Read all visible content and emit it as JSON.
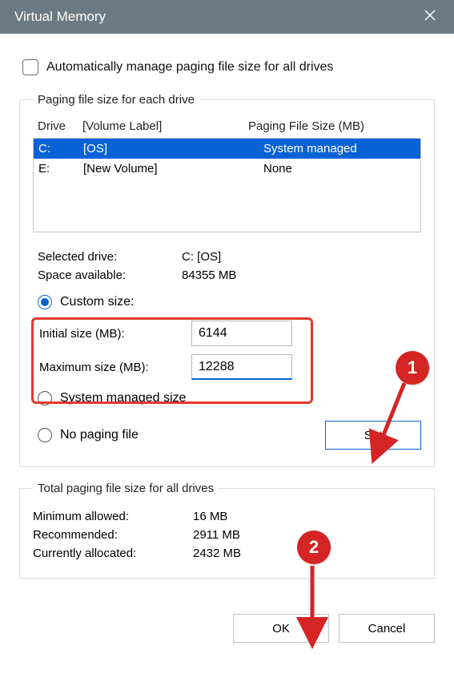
{
  "title": "Virtual Memory",
  "auto_manage_label": "Automatically manage paging file size for all drives",
  "group1": {
    "legend": "Paging file size for each drive",
    "headers": {
      "drive": "Drive",
      "volume": "[Volume Label]",
      "paging": "Paging File Size (MB)"
    },
    "rows": [
      {
        "drive": "C:",
        "volume": "[OS]",
        "paging": "System managed",
        "selected": true
      },
      {
        "drive": "E:",
        "volume": "[New Volume]",
        "paging": "None",
        "selected": false
      }
    ],
    "selected_drive_label": "Selected drive:",
    "selected_drive_value": "C:  [OS]",
    "space_label": "Space available:",
    "space_value": "84355 MB",
    "radio_custom": "Custom size:",
    "initial_label": "Initial size (MB):",
    "initial_value": "6144",
    "max_label": "Maximum size (MB):",
    "max_value": "12288",
    "radio_sys": "System managed size",
    "radio_none": "No paging file",
    "set_btn": "Set"
  },
  "group2": {
    "legend": "Total paging file size for all drives",
    "min_label": "Minimum allowed:",
    "min_value": "16 MB",
    "rec_label": "Recommended:",
    "rec_value": "2911 MB",
    "cur_label": "Currently allocated:",
    "cur_value": "2432 MB"
  },
  "footer": {
    "ok": "OK",
    "cancel": "Cancel"
  },
  "anno": {
    "one": "1",
    "two": "2"
  }
}
